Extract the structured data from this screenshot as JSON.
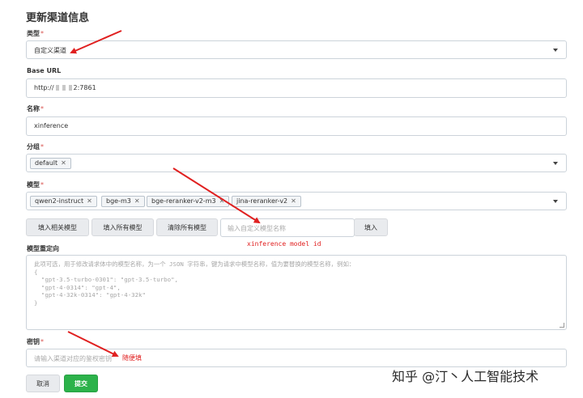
{
  "form": {
    "title": "更新渠道信息",
    "type": {
      "label": "类型",
      "value": "自定义渠道"
    },
    "base_url": {
      "label": "Base URL",
      "prefix": "http://",
      "suffix": "2:7861"
    },
    "name": {
      "label": "名称",
      "value": "xinference"
    },
    "group": {
      "label": "分组",
      "tags": [
        "default"
      ]
    },
    "models": {
      "label": "模型",
      "tags": [
        "qwen2-instruct",
        "bge-m3",
        "bge-reranker-v2-m3",
        "jina-reranker-v2"
      ]
    },
    "model_buttons": {
      "fill_related": "填入相关模型",
      "fill_all": "填入所有模型",
      "clear_all": "清除所有模型",
      "custom_placeholder": "输入自定义模型名称",
      "fill": "填入"
    },
    "mapping": {
      "label": "模型重定向",
      "placeholder": "此项可选，用于修改请求体中的模型名称，为一个 JSON 字符串，键为请求中模型名称，值为要替换的模型名称，例如：\n{\n  \"gpt-3.5-turbo-0301\": \"gpt-3.5-turbo\",\n  \"gpt-4-0314\": \"gpt-4\",\n  \"gpt-4-32k-0314\": \"gpt-4-32k\"\n}"
    },
    "key": {
      "label": "密钥",
      "placeholder": "请输入渠道对应的鉴权密钥"
    },
    "actions": {
      "cancel": "取消",
      "submit": "提交"
    }
  },
  "annotations": {
    "model_id_note": "xinference model id",
    "key_note": "随便填"
  },
  "watermark": "知乎 @汀丶人工智能技术",
  "colors": {
    "annotation": "#e02020",
    "submit": "#2cb24a",
    "required": "#d9534f"
  }
}
